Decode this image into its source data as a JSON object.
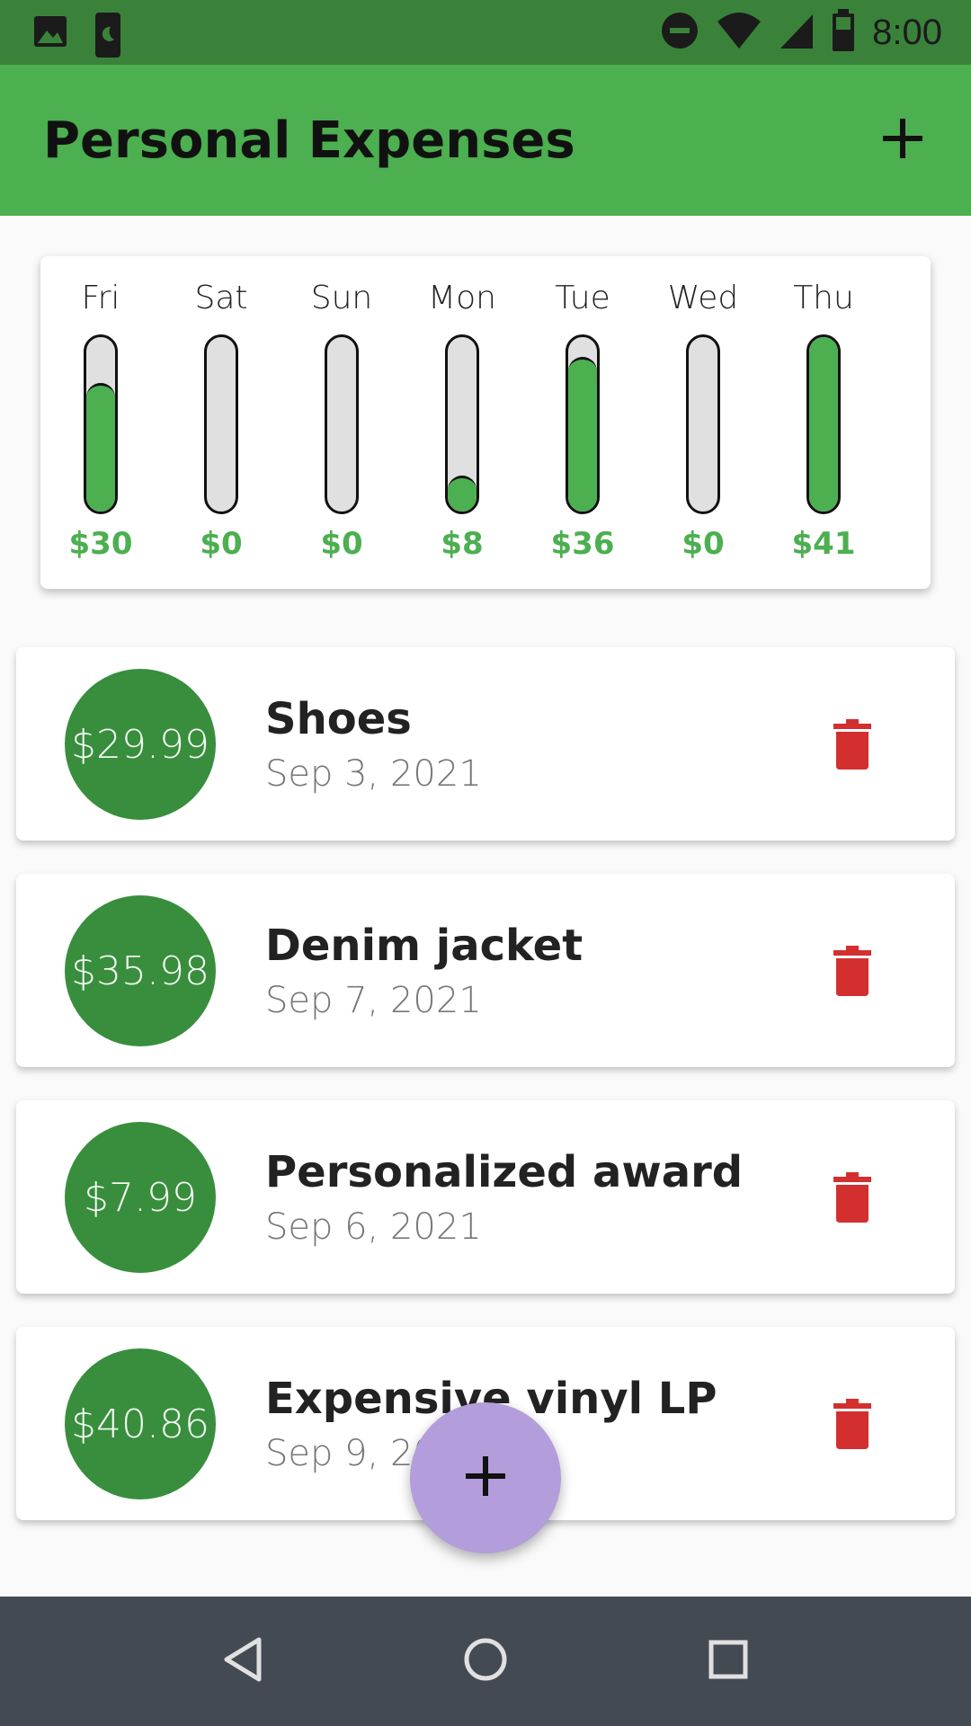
{
  "status_bar": {
    "time": "8:00",
    "left_icons": [
      "image-icon",
      "phone-icon"
    ],
    "right_icons": [
      "do-not-disturb-icon",
      "wifi-icon",
      "signal-icon",
      "battery-icon"
    ]
  },
  "app_bar": {
    "title": "Personal Expenses",
    "add_icon": "plus-icon"
  },
  "chart": {
    "days": [
      {
        "label": "Fri",
        "amount": "$30",
        "fraction": 0.72
      },
      {
        "label": "Sat",
        "amount": "$0",
        "fraction": 0
      },
      {
        "label": "Sun",
        "amount": "$0",
        "fraction": 0
      },
      {
        "label": "Mon",
        "amount": "$8",
        "fraction": 0.19
      },
      {
        "label": "Tue",
        "amount": "$36",
        "fraction": 0.87
      },
      {
        "label": "Wed",
        "amount": "$0",
        "fraction": 0
      },
      {
        "label": "Thu",
        "amount": "$41",
        "fraction": 1.0
      }
    ]
  },
  "transactions": [
    {
      "amount": "$29.99",
      "title": "Shoes",
      "date": "Sep 3, 2021"
    },
    {
      "amount": "$35.98",
      "title": "Denim jacket",
      "date": "Sep 7, 2021"
    },
    {
      "amount": "$7.99",
      "title": "Personalized award",
      "date": "Sep 6, 2021"
    },
    {
      "amount": "$40.86",
      "title": "Expensive vinyl LP",
      "date": "Sep 9, 2021"
    }
  ],
  "fab": {
    "icon": "plus-icon"
  },
  "nav_bar": {
    "icons": [
      "back-icon",
      "home-icon",
      "recents-icon"
    ]
  },
  "colors": {
    "primary": "#4caf50",
    "primary_dark": "#388e3c",
    "status_bar": "#3a823a",
    "accent": "#b39ddb",
    "delete": "#d32f2f"
  }
}
